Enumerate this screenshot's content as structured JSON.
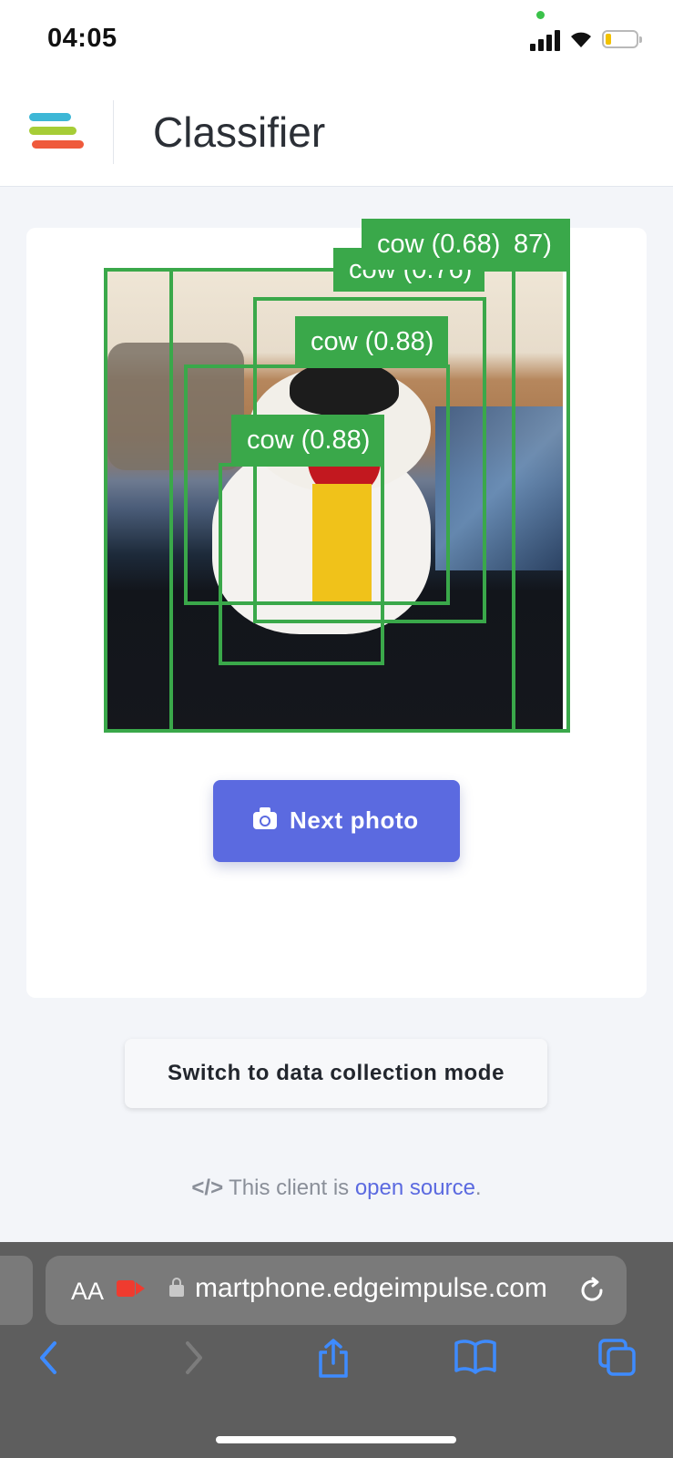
{
  "status": {
    "time": "04:05"
  },
  "header": {
    "title": "Classifier"
  },
  "detections": [
    {
      "label": "cow (0.68)"
    },
    {
      "label": "87)"
    },
    {
      "label": "cow (0.76)"
    },
    {
      "label": "cow (0.88)"
    },
    {
      "label": "cow (0.88)"
    }
  ],
  "actions": {
    "next_photo": "Next photo",
    "switch_mode": "Switch to data collection mode"
  },
  "footer": {
    "code": "</>",
    "text": "This client is",
    "link": "open source",
    "period": "."
  },
  "browser": {
    "text_size": "AA",
    "url": "martphone.edgeimpulse.com"
  },
  "colors": {
    "detection_box": "#3aa84a",
    "primary_button": "#5b6ae0",
    "link": "#5b6ae0"
  }
}
